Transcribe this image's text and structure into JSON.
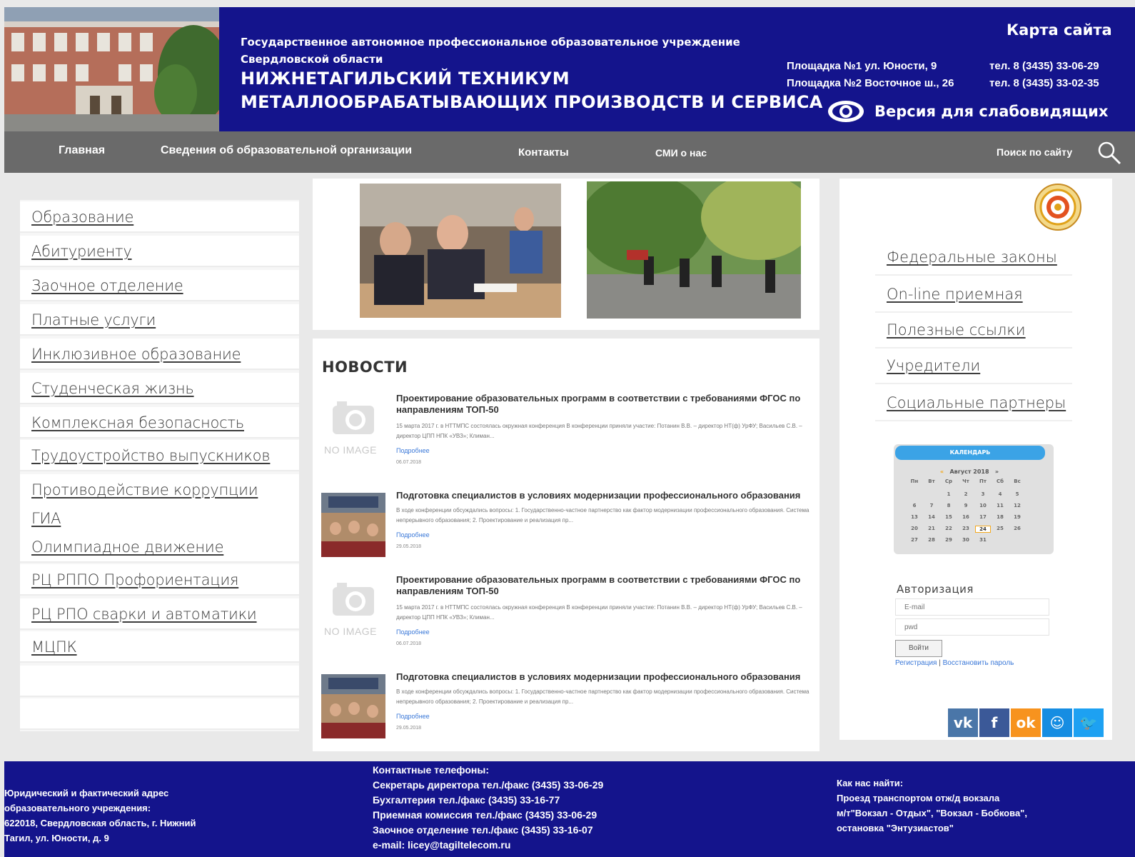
{
  "header": {
    "org_type_line1": "Государственное автономное профессиональное образовательное учреждение",
    "org_type_line2": "Свердловской области",
    "org_name_line1": "НИЖНЕТАГИЛЬСКИЙ ТЕХНИКУМ",
    "org_name_line2": "МЕТАЛЛООБРАБАТЫВАЮЩИХ ПРОИЗВОДСТВ И СЕРВИСА",
    "sitemap_link": "Карта сайта",
    "site1_address": "Площадка №1 ул. Юности, 9",
    "site1_phone": "тел. 8 (3435) 33-06-29",
    "site2_address": "Площадка №2 Восточное ш., 26",
    "site2_phone": "тел. 8 (3435) 33-02-35",
    "low_vision_link": "Версия для слабовидящих"
  },
  "nav": {
    "items": [
      "Главная",
      "Сведения об образовательной организации",
      "Контакты",
      "СМИ о нас"
    ],
    "search_label": "Поиск по сайту"
  },
  "left_menu": {
    "items": [
      "Образование",
      "Абитуриенту",
      "Заочное отделение",
      "Платные услуги",
      "Инклюзивное образование",
      "Студенческая жизнь",
      "Комплексная безопасность",
      "Трудоустройство выпускников",
      "Противодействие коррупции",
      "ГИА",
      "Олимпиадное движение",
      "РЦ РППО Профориентация",
      "РЦ РПО сварки и автоматики",
      "МЦПК"
    ]
  },
  "news": {
    "title": "НОВОСТИ",
    "no_image_label": "NO IMAGE",
    "items": [
      {
        "headline": "Проектирование образовательных программ в соответствии с требованиями ФГОС по направлениям ТОП-50",
        "excerpt": "15 марта 2017 г. в НТТМПС состоялась окружная конференция В конференции приняли участие: Потанин В.В. – директор НТ(ф) УрФУ; Васильев С.В. – директор ЦПП НПК «УВЗ»; Климан...",
        "more": "Подробнее",
        "date": "06.07.2018",
        "thumb": "no-image"
      },
      {
        "headline": "Подготовка специалистов в условиях модернизации профессионального образования",
        "excerpt": "В ходе конференции обсуждались вопросы: 1. Государственно-частное партнерство как фактор модернизации профессионального образования. Система непрерывного образования; 2. Проектирование и реализация пр...",
        "more": "Подробнее",
        "date": "29.05.2018",
        "thumb": "photo"
      },
      {
        "headline": "Проектирование образовательных программ в соответствии с требованиями ФГОС по направлениям ТОП-50",
        "excerpt": "15 марта 2017 г. в НТТМПС состоялась окружная конференция В конференции приняли участие: Потанин В.В. – директор НТ(ф) УрФУ; Васильев С.В. – директор ЦПП НПК «УВЗ»; Климан...",
        "more": "Подробнее",
        "date": "06.07.2018",
        "thumb": "no-image"
      },
      {
        "headline": "Подготовка специалистов в условиях модернизации профессионального образования",
        "excerpt": "В ходе конференции обсуждались вопросы: 1. Государственно-частное партнерство как фактор модернизации профессионального образования. Система непрерывного образования; 2. Проектирование и реализация пр...",
        "more": "Подробнее",
        "date": "29.05.2018",
        "thumb": "photo"
      }
    ]
  },
  "right_menu": {
    "items": [
      "Федеральные законы",
      "On-line приемная",
      "Полезные ссылки",
      "Учредители",
      "Социальные партнеры"
    ]
  },
  "calendar": {
    "title": "КАЛЕНДАРЬ",
    "month": "Август 2018",
    "prev": "«",
    "next": "»",
    "weekdays": [
      "Пн",
      "Вт",
      "Ср",
      "Чт",
      "Пт",
      "Сб",
      "Вс"
    ],
    "weeks": [
      [
        "",
        "",
        "1",
        "2",
        "3",
        "4",
        "5"
      ],
      [
        "6",
        "7",
        "8",
        "9",
        "10",
        "11",
        "12"
      ],
      [
        "13",
        "14",
        "15",
        "16",
        "17",
        "18",
        "19"
      ],
      [
        "20",
        "21",
        "22",
        "23",
        "24",
        "25",
        "26"
      ],
      [
        "27",
        "28",
        "29",
        "30",
        "31",
        "",
        ""
      ]
    ],
    "today": "24"
  },
  "auth": {
    "title": "Авторизация",
    "email_placeholder": "E-mail",
    "password_placeholder": "pwd",
    "login_button": "Войти",
    "register_link": "Регистрация",
    "separator": "|",
    "restore_link": "Восстановить пароль"
  },
  "social": {
    "items": [
      {
        "icon": "vk-icon",
        "glyph": "vk",
        "color": "#4a76a8"
      },
      {
        "icon": "facebook-icon",
        "glyph": "f",
        "color": "#3b5998"
      },
      {
        "icon": "odnoklassniki-icon",
        "glyph": "ok",
        "color": "#f7931e"
      },
      {
        "icon": "mailru-icon",
        "glyph": "☺",
        "color": "#168de2"
      },
      {
        "icon": "twitter-icon",
        "glyph": "🐦",
        "color": "#1da1f2"
      }
    ]
  },
  "footer": {
    "address_label": "Юридический и фактический адрес",
    "address_label2": "образовательного учреждения:",
    "address_line1": "622018, Свердловская область, г. Нижний",
    "address_line2": "Тагил, ул. Юности, д. 9",
    "phones_title": "Контактные телефоны:",
    "phones": [
      "Секретарь директора тел./факс (3435) 33-06-29",
      "Бухгалтерия тел./факс (3435) 33-16-77",
      "Приемная комиссия тел./факс (3435) 33-06-29",
      "Заочное отделение тел./факс (3435) 33-16-07"
    ],
    "email": "e-mail: licey@tagiltelecom.ru",
    "find_title": "Как нас найти:",
    "find_line1": "Проезд транспортом отж/д вокзала",
    "find_line2": "м/т\"Вокзал - Отдых\", \"Вокзал - Бобкова\",",
    "find_line3": "остановка \"Энтузиастов\""
  },
  "colors": {
    "header_bg": "#14148c",
    "nav_bg": "#6a6a6a",
    "link_blue": "#3a78d8",
    "calendar_today": "#f3a81c"
  }
}
